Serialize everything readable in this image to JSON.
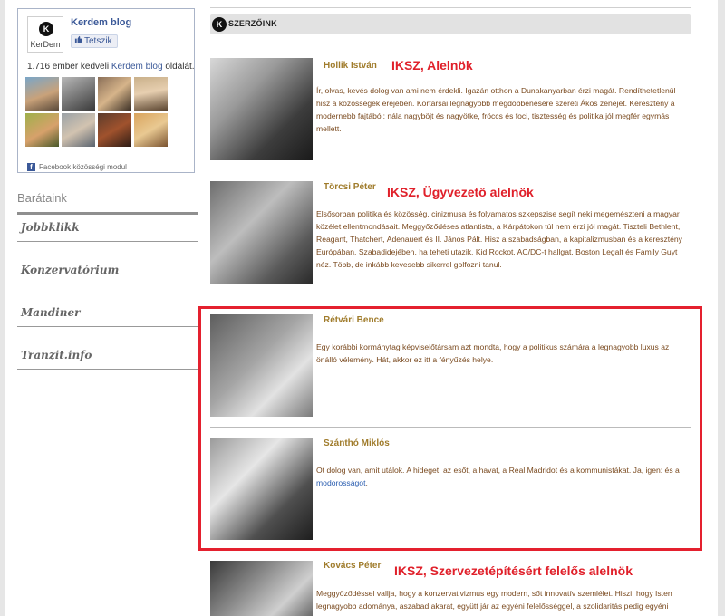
{
  "facebook": {
    "page_name": "Kerdem blog",
    "logo_text": "KerDem",
    "logo_letter": "K",
    "like_label": "Tetszik",
    "count_prefix": "1.716 ember kedveli",
    "count_link": "Kerdem blog",
    "count_suffix": "oldalát.",
    "footer": "Facebook közösségi modul",
    "footer_icon": "f"
  },
  "friends": {
    "title": "Barátaink",
    "items": [
      {
        "label": "Jobbklikk"
      },
      {
        "label": "Konzervatórium"
      },
      {
        "label": "Mandiner"
      },
      {
        "label": "Tranzit.info"
      }
    ]
  },
  "section": {
    "badge": "K",
    "title": "SZERZŐINK"
  },
  "authors": [
    {
      "name": "Hollik István",
      "role": "IKSZ, Alelnök",
      "bio": "Ír, olvas, kevés dolog van ami nem érdekli. Igazán otthon a Dunakanyarban érzi magát. Rendíthetetlenül hisz a közösségek erejében. Kortársai legnagyobb megdöbbenésére szereti Ákos zenéjét. Keresztény a modernebb fajtából: nála nagyböjt és nagyötke, fröccs és foci, tisztesség és politika jól megfér egymás mellett."
    },
    {
      "name": "Törcsi Péter",
      "role": "IKSZ, Ügyvezető alelnök",
      "bio": "Elsősorban politika és közösség, cinizmusa és folyamatos szkepszise segít neki megemészteni a magyar közélet ellentmondásait. Meggyőződéses atlantista, a Kárpátokon túl nem érzi jól magát. Tiszteli Bethlent, Reagant, Thatchert, Adenauert és II. János Pált. Hisz a szabadságban, a kapitalizmusban és a keresztény Európában. Szabadidejében, ha teheti utazik, Kid Rockot, AC/DC-t hallgat, Boston Legalt és Family Guyt néz. Több, de inkább kevesebb sikerrel golfozni tanul."
    },
    {
      "name": "Rétvári Bence",
      "role": "",
      "bio": "Egy korábbi kormánytag képviselőtársam azt mondta, hogy a politikus számára a legnagyobb luxus az önálló vélemény. Hát, akkor ez itt a fényűzés helye."
    },
    {
      "name": "Szánthó Miklós",
      "role": "",
      "bio": "Öt dolog van, amit utálok. A hideget, az esőt, a havat, a Real Madridot és a kommunistákat. Ja, igen: és a",
      "bio_link": "modorosságot",
      "bio_end": "."
    },
    {
      "name": "Kovács Péter",
      "role": "IKSZ, Szervezetépítésért felelős alelnök",
      "bio": "Meggyőződéssel vallja, hogy a konzervativizmus egy modern, sőt innovatív szemlélet. Hiszi, hogy Isten legnagyobb adománya, aszabad akarat, együtt jár az egyéni felelősséggel, a szolidaritás pedig egyéni döntés kérdése. Hivatása, hogy a tehetséget oda juttassa, ahol a legjobban kitudnak bontakozni."
    }
  ],
  "colors": {
    "author_name": "#a07c2c",
    "role": "#e0202a",
    "bio_text": "#7a4a1f",
    "highlight": "#e4202e",
    "facebook": "#3b5998"
  }
}
